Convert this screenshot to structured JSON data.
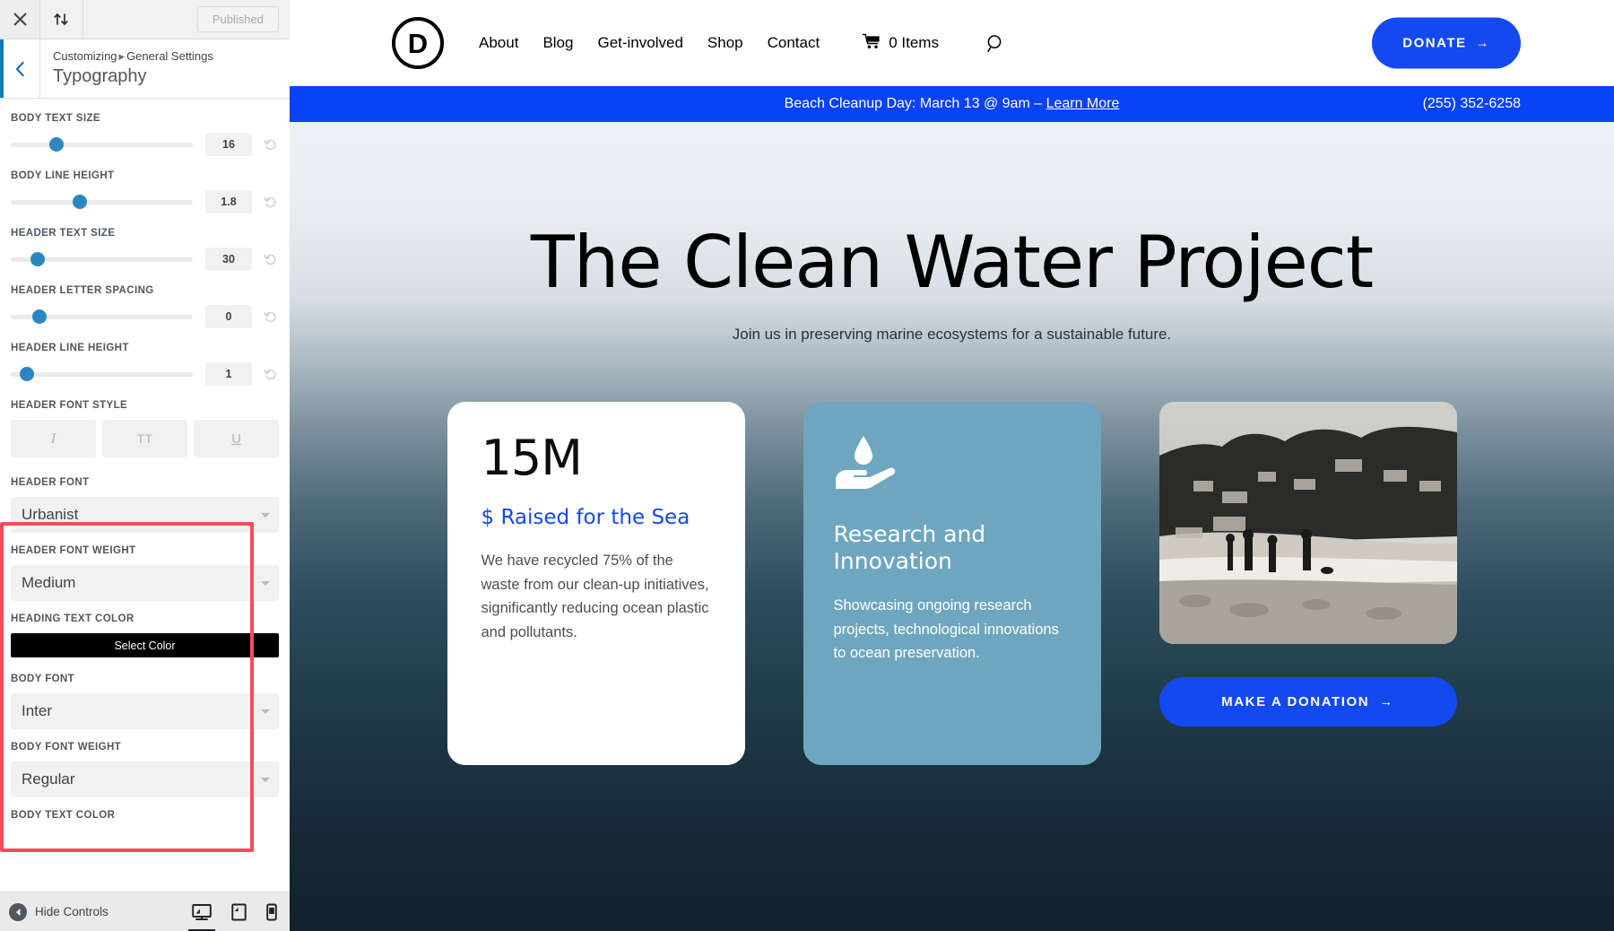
{
  "customizer": {
    "topbar": {
      "close_icon": "close-icon",
      "devices_icon": "collapse-sort-icon",
      "publish_label": "Published"
    },
    "header": {
      "back_icon": "chevron-left-icon",
      "breadcrumb_root": "Customizing",
      "breadcrumb_sep": "▸",
      "breadcrumb_parent": "General Settings",
      "panel_title": "Typography"
    },
    "sliders": [
      {
        "label": "Body Text Size",
        "value": "16",
        "percent": 25
      },
      {
        "label": "Body Line Height",
        "value": "1.8",
        "percent": 38
      },
      {
        "label": "Header Text Size",
        "value": "30",
        "percent": 15
      },
      {
        "label": "Header Letter Spacing",
        "value": "0",
        "percent": 16
      },
      {
        "label": "Header Line Height",
        "value": "1",
        "percent": 9
      }
    ],
    "font_style": {
      "label": "Header Font Style",
      "buttons": [
        {
          "name": "italic-toggle",
          "glyph": "I"
        },
        {
          "name": "uppercase-toggle",
          "glyph": "TT"
        },
        {
          "name": "underline-toggle",
          "glyph": "U"
        }
      ]
    },
    "fields": {
      "header_font": {
        "label": "Header Font",
        "value": "Urbanist"
      },
      "header_font_weight": {
        "label": "Header Font Weight",
        "value": "Medium"
      },
      "heading_text_color": {
        "label": "Heading Text Color",
        "button": "Select Color",
        "swatch": "#000000"
      },
      "body_font": {
        "label": "Body Font",
        "value": "Inter"
      },
      "body_font_weight": {
        "label": "Body Font Weight",
        "value": "Regular"
      },
      "body_text_color": {
        "label": "Body Text Color"
      }
    },
    "highlight_color": "#fb4b5a",
    "footer": {
      "hide_controls_label": "Hide Controls",
      "devices": [
        {
          "name": "desktop-view-button",
          "active": true
        },
        {
          "name": "tablet-view-button",
          "active": false
        },
        {
          "name": "mobile-view-button",
          "active": false
        }
      ]
    }
  },
  "site": {
    "logo_letter": "D",
    "nav": [
      {
        "label": "About"
      },
      {
        "label": "Blog"
      },
      {
        "label": "Get-involved"
      },
      {
        "label": "Shop"
      },
      {
        "label": "Contact"
      }
    ],
    "cart_label": "0 Items",
    "donate_label": "DONATE",
    "donate_arrow": "→",
    "announce": {
      "text": "Beach Cleanup Day: March 13 @ 9am – ",
      "link": "Learn More",
      "phone": "(255) 352-6258",
      "bg": "#0a42f5"
    },
    "hero": {
      "title": "The Clean Water Project",
      "subtitle": "Join us in preserving marine ecosystems for a sustainable future."
    },
    "cards": {
      "stat": {
        "number": "15M",
        "label": "$ Raised for the Sea",
        "label_color": "#1449f0",
        "body": "We have recycled 75% of the waste from our clean-up initiatives, significantly reducing ocean plastic and pollutants."
      },
      "feature": {
        "icon": "water-drop-in-hand-icon",
        "title": "Research and Innovation",
        "body": "Showcasing ongoing research projects, technological innovations to ocean preservation.",
        "bg": "#6fa6bf"
      },
      "photo": {
        "alt": "beach-coastline-photo",
        "cta_label": "MAKE A DONATION",
        "cta_arrow": "→"
      }
    }
  }
}
